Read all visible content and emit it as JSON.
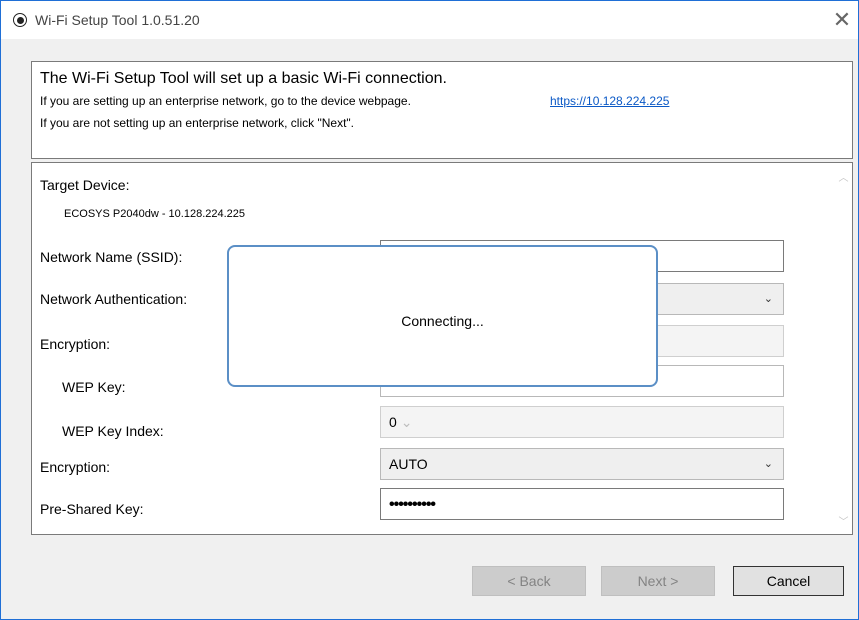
{
  "window": {
    "title": "Wi-Fi Setup Tool 1.0.51.20",
    "close_glyph": "✕"
  },
  "header": {
    "main": "The Wi-Fi Setup Tool will set up a basic Wi-Fi connection.",
    "line1": "If you are setting up an enterprise network, go to the device webpage.",
    "link": "https://10.128.224.225",
    "line2": "If you are not setting up an enterprise network, click \"Next\"."
  },
  "form": {
    "target_device_label": "Target Device:",
    "target_device_value": "ECOSYS P2040dw - 10.128.224.225",
    "ssid_label": "Network Name (SSID):",
    "ssid_value": "",
    "auth_label": "Network Authentication:",
    "encryption1_label": "Encryption:",
    "wep_key_label": "WEP Key:",
    "wep_index_label": "WEP Key Index:",
    "wep_index_value": "0",
    "encryption2_label": "Encryption:",
    "encryption2_value": "AUTO",
    "psk_label": "Pre-Shared Key:",
    "psk_value": "••••••••••"
  },
  "dialog": {
    "text": "Connecting..."
  },
  "buttons": {
    "back": "< Back",
    "next": "Next >",
    "cancel": "Cancel"
  },
  "colors": {
    "window_border": "#1f6fd6",
    "link": "#0b59c6",
    "dialog_border": "#5b8fc6"
  },
  "icons": {
    "chevron": "⌄",
    "scroll_up": "︿",
    "scroll_down": "﹀"
  }
}
